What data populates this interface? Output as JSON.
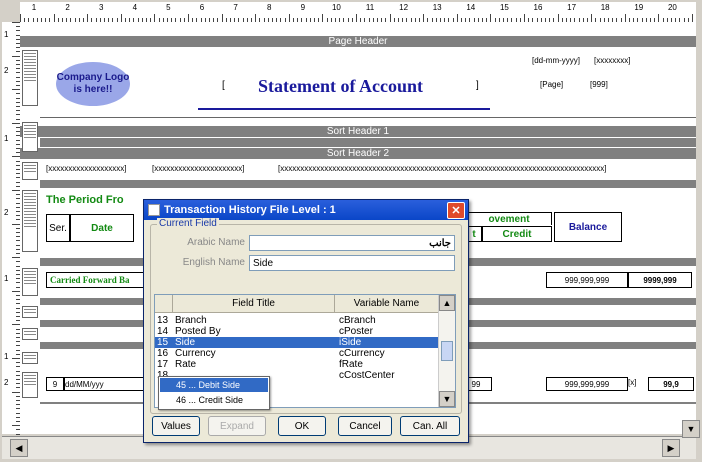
{
  "ruler": {
    "numbers": [
      "1",
      "2",
      "3",
      "4",
      "5",
      "6",
      "7",
      "8",
      "9",
      "10",
      "11",
      "12",
      "13",
      "14",
      "15",
      "16",
      "17",
      "18",
      "19",
      "20"
    ]
  },
  "left_ruler": {
    "numbers": [
      "1",
      "2",
      "",
      "1",
      "",
      "2",
      "",
      "1",
      "",
      "1",
      "2",
      ""
    ]
  },
  "report": {
    "page_header": "Page Header",
    "logo": "Company Logo is here!!",
    "title": "Statement of Account",
    "date_placeholder": "dd-mm-yyyy",
    "time_placeholder": "xxxxxxxx",
    "page_label": "Page",
    "page_num": "999",
    "sort_header_1": "Sort Header 1",
    "sort_header_2": "Sort Header 2",
    "xfield_1": "xxxxxxxxxxxxxxxxxxx",
    "xfield_2": "xxxxxxxxxxxxxxxxxxxxxx",
    "xfield_3": "xxxxxxxxxxxxxxxxxxxxxxxxxxxxxxxxxxxxxxxxxxxxxxxxxxxxxxxxxxxxxxxxxxxxxxxxxxxxxxxxx",
    "period_label": "The Period Fro",
    "col_ser": "Ser.",
    "col_date": "Date",
    "movement": "ovement",
    "col_t": "t",
    "col_credit": "Credit",
    "col_balance": "Balance",
    "carried_forward": "Carried Forward Ba",
    "amount_1": "999,999,999",
    "amount_2": "9999,999",
    "row_ser": "9",
    "row_date": "dd/MM/yyy",
    "row_99": "99",
    "amount_3": "999,999,999",
    "row_x": "x",
    "row_end": "99,9"
  },
  "dialog": {
    "title": "Transaction History File Level : 1",
    "group_label": "Current Field",
    "arabic_label": "Arabic Name",
    "arabic_value": "جانب",
    "english_label": "English Name",
    "english_value": "Side",
    "grid_headers": [
      "Field Title",
      "Variable Name"
    ],
    "rows": [
      {
        "n": "13",
        "title": "Branch",
        "var": "cBranch"
      },
      {
        "n": "14",
        "title": "Posted By",
        "var": "cPoster"
      },
      {
        "n": "15",
        "title": "Side",
        "var": "iSide"
      },
      {
        "n": "16",
        "title": "Currency",
        "var": "cCurrency"
      },
      {
        "n": "17",
        "title": "Rate",
        "var": "fRate"
      },
      {
        "n": "18",
        "title": "",
        "var": "cCostCenter"
      }
    ],
    "popup_items": [
      "45 ... Debit Side",
      "46 ... Credit Side"
    ],
    "buttons": {
      "values": "Values",
      "expand": "Expand",
      "ok": "OK",
      "cancel": "Cancel",
      "can_all": "Can. All"
    }
  }
}
